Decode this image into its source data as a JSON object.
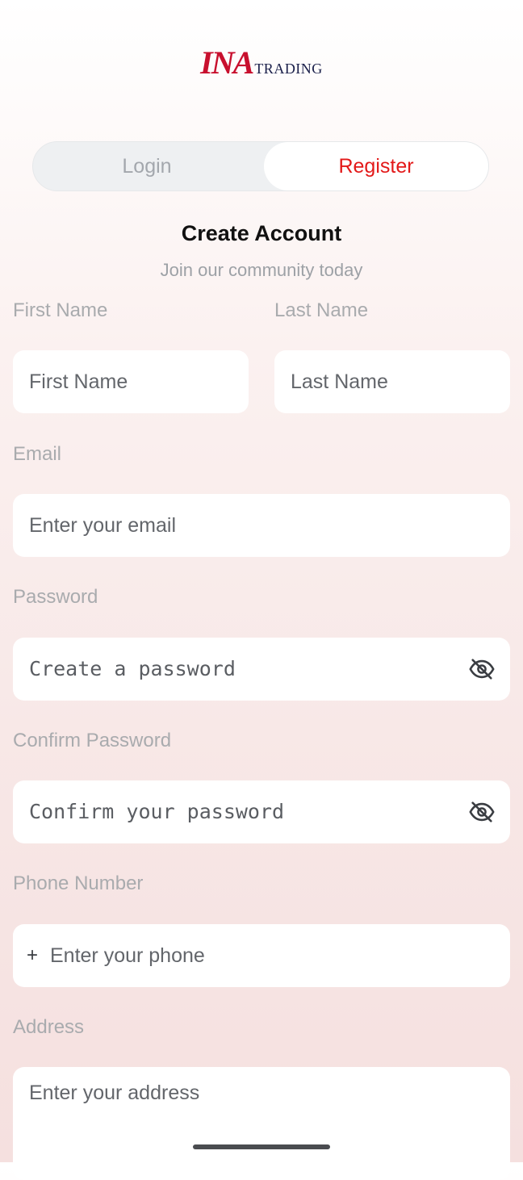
{
  "logo": {
    "mark": "INA",
    "word": "TRADING",
    "brand_color": "#c8102e"
  },
  "tabs": [
    {
      "label": "Login",
      "active": false
    },
    {
      "label": "Register",
      "active": true
    }
  ],
  "header": {
    "title": "Create Account",
    "subtitle": "Join our community today"
  },
  "form": {
    "first_name": {
      "label": "First Name",
      "placeholder": "First Name"
    },
    "last_name": {
      "label": "Last Name",
      "placeholder": "Last Name"
    },
    "email": {
      "label": "Email",
      "placeholder": "Enter your email"
    },
    "password": {
      "label": "Password",
      "placeholder": "Create a password",
      "icon": "eye-off-icon"
    },
    "confirm_password": {
      "label": "Confirm Password",
      "placeholder": "Confirm your password",
      "icon": "eye-off-icon"
    },
    "phone": {
      "label": "Phone Number",
      "prefix": "+",
      "placeholder": "Enter your phone"
    },
    "address": {
      "label": "Address",
      "placeholder": "Enter your address"
    }
  },
  "colors": {
    "accent": "#e31919",
    "label": "#a9abae"
  }
}
